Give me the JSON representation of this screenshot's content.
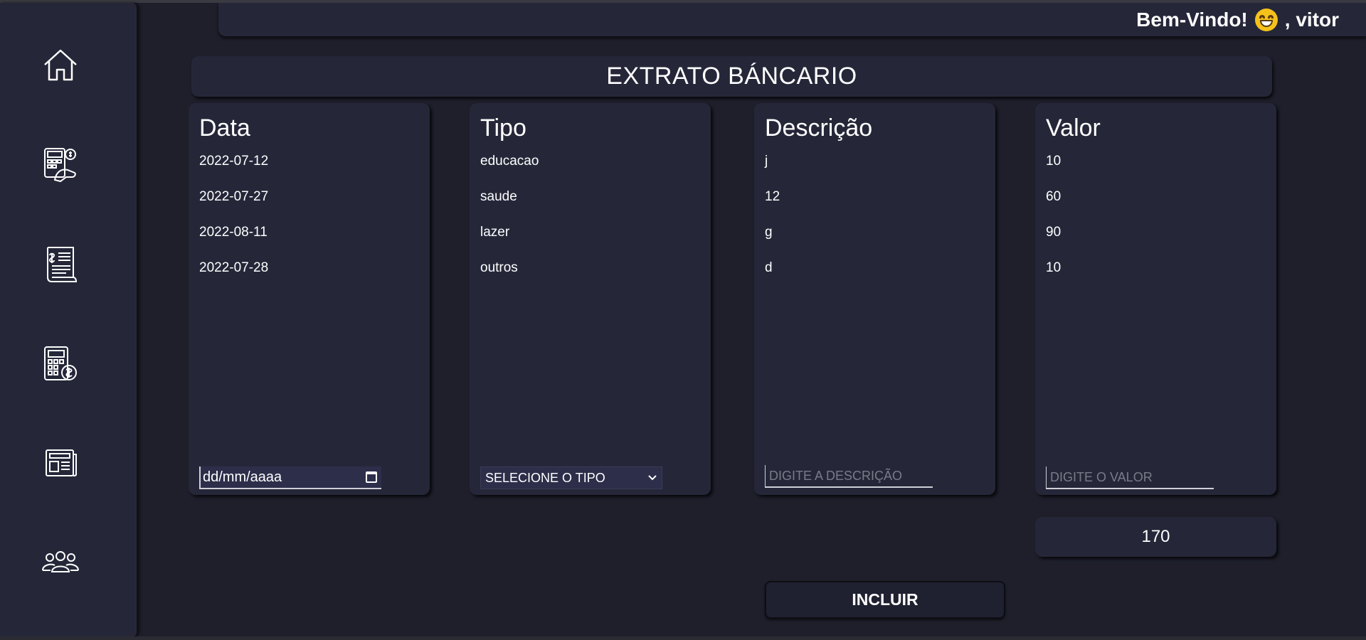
{
  "header": {
    "greeting": "Bem-Vindo!",
    "greeting_emoji": "grinning-face-emoji",
    "user_separator": ", vitor"
  },
  "sidebar": {
    "items": [
      {
        "name": "home",
        "icon": "home-icon"
      },
      {
        "name": "budget",
        "icon": "calculator-money-icon"
      },
      {
        "name": "statement",
        "icon": "invoice-icon"
      },
      {
        "name": "calculator",
        "icon": "calculator-dollar-icon"
      },
      {
        "name": "news",
        "icon": "newspaper-icon"
      },
      {
        "name": "users",
        "icon": "group-icon"
      }
    ]
  },
  "main": {
    "title": "EXTRATO BÁNCARIO",
    "columns": {
      "data": {
        "header": "Data",
        "values": [
          "2022-07-12",
          "2022-07-27",
          "2022-08-11",
          "2022-07-28"
        ],
        "input_placeholder": "dd/mm/aaaa"
      },
      "tipo": {
        "header": "Tipo",
        "values": [
          "educacao",
          "saude",
          "lazer",
          "outros"
        ],
        "select_value": "SELECIONE O TIPO"
      },
      "descricao": {
        "header": "Descrição",
        "values": [
          "j",
          "12",
          "g",
          "d"
        ],
        "input_placeholder": "DIGITE A DESCRIÇÃO"
      },
      "valor": {
        "header": "Valor",
        "values": [
          "10",
          "60",
          "90",
          "10"
        ],
        "input_placeholder": "DIGITE O VALOR"
      }
    },
    "total": "170",
    "include_button": "INCLUIR"
  },
  "colors": {
    "background": "#1e1f2b",
    "panel": "#252739",
    "text": "#ffffff"
  }
}
